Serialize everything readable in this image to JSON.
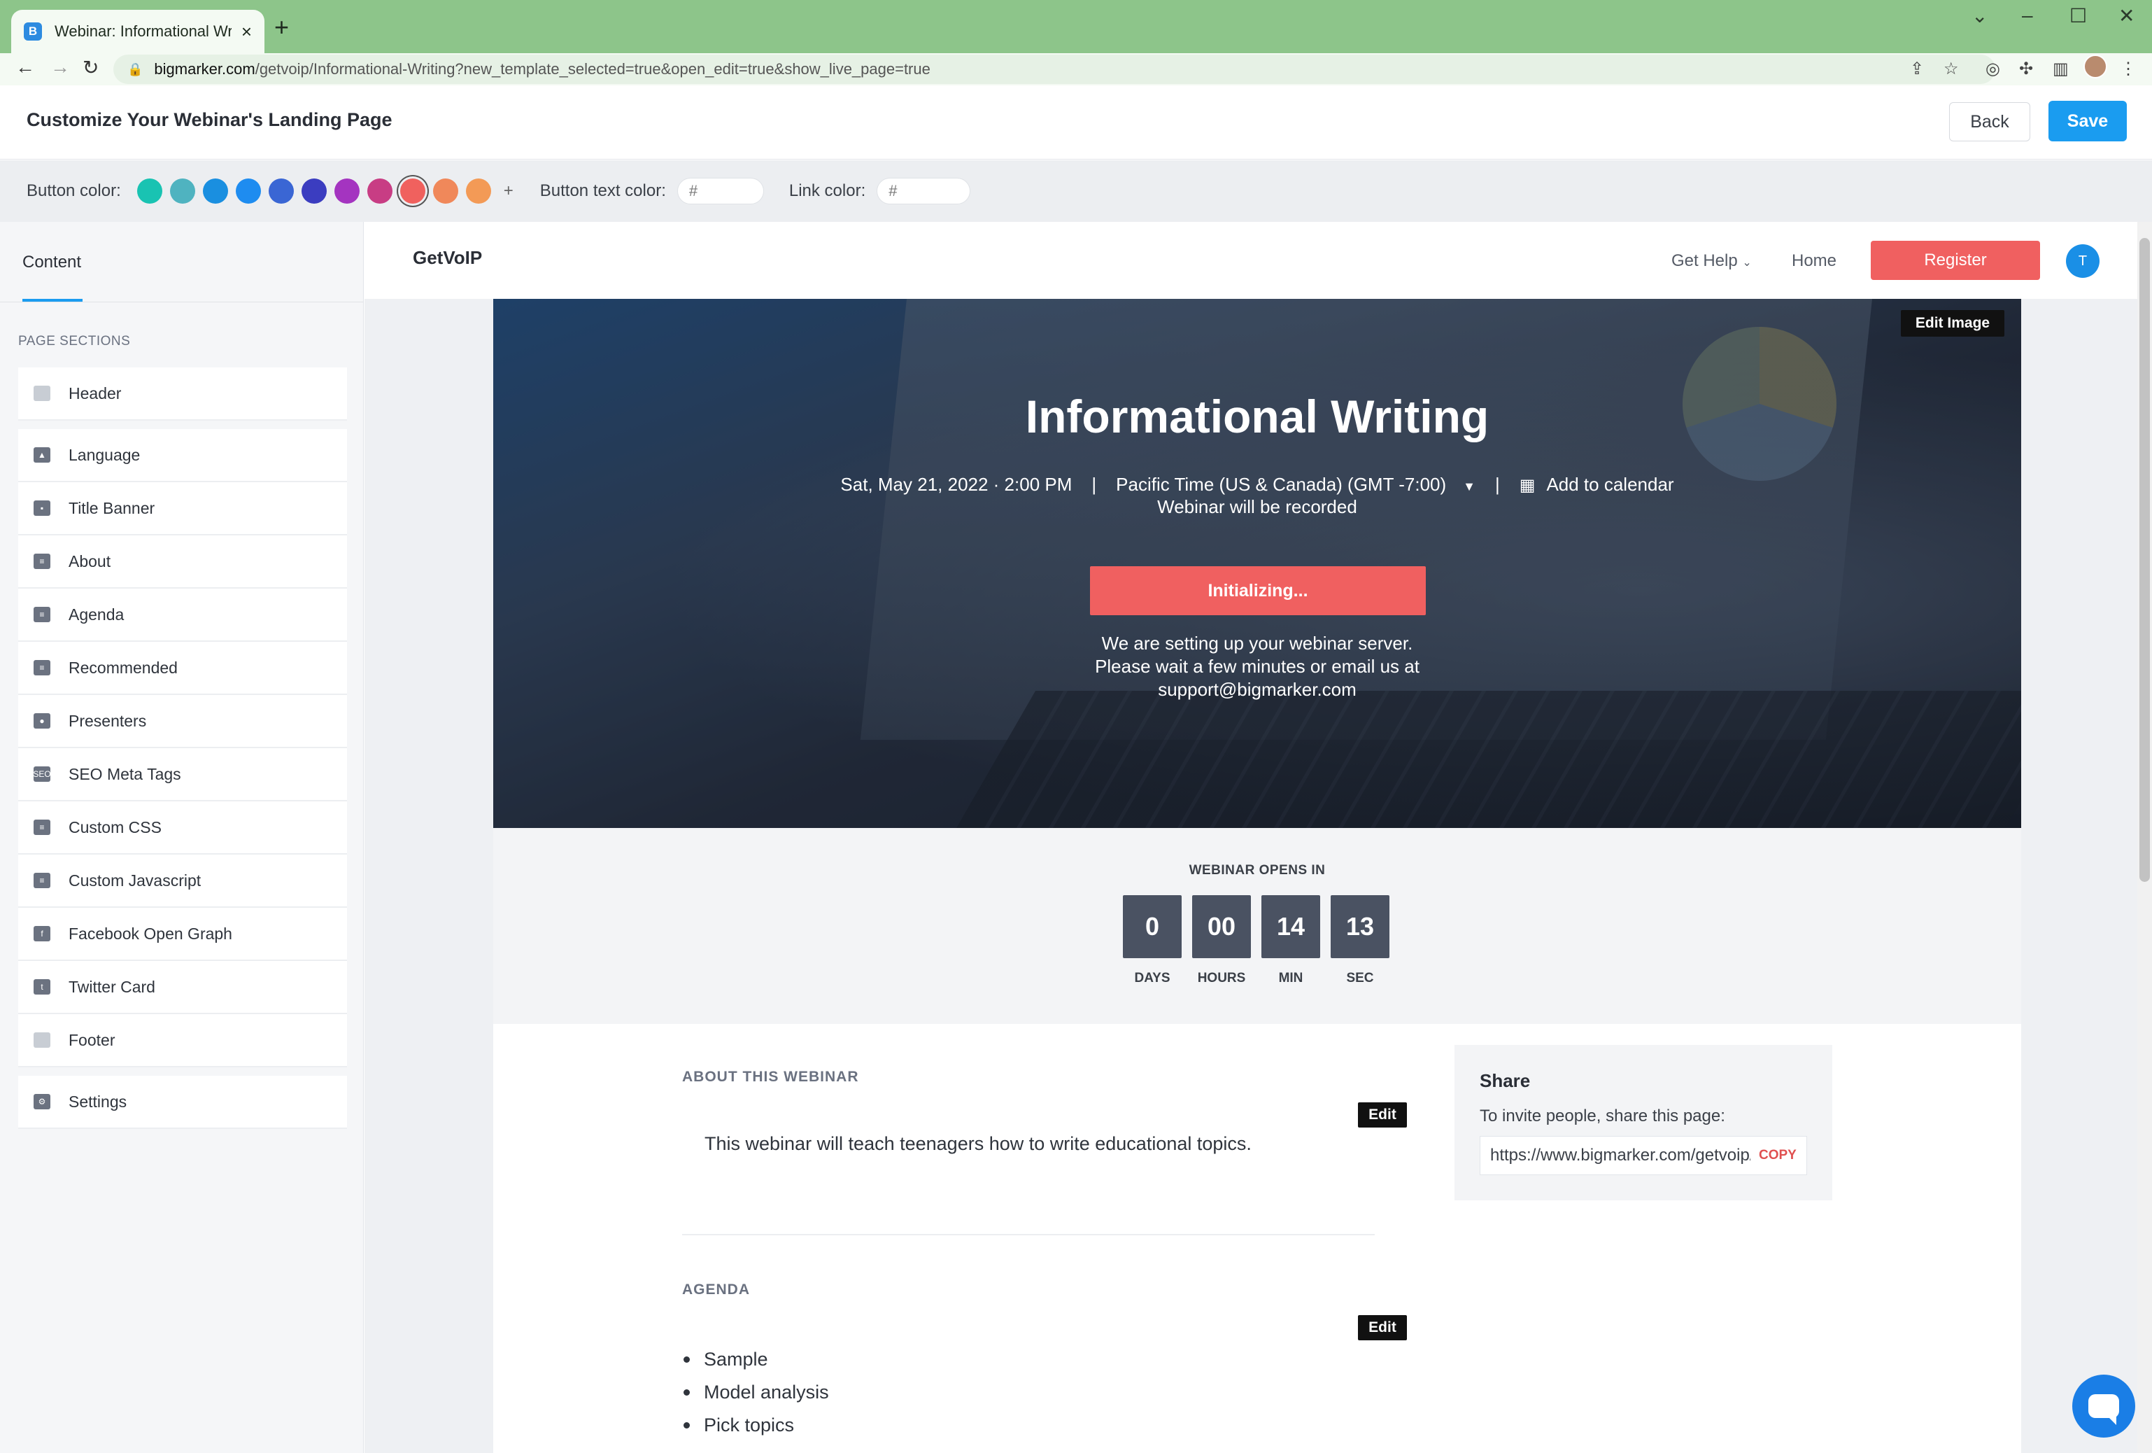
{
  "browser": {
    "tab_title": "Webinar: Informational Writing b",
    "favicon_letter": "B",
    "url_host": "bigmarker.com",
    "url_path": "/getvoip/Informational-Writing?new_template_selected=true&open_edit=true&show_live_page=true"
  },
  "app": {
    "title": "Customize Your Webinar's Landing Page",
    "back_label": "Back",
    "save_label": "Save"
  },
  "colorbar": {
    "button_color_label": "Button color:",
    "swatches": [
      "#19c3b2",
      "#4fb3c0",
      "#1a8fe0",
      "#1e8cf0",
      "#3a66d4",
      "#3b3dc0",
      "#a434c0",
      "#c83d84",
      "#f0615e",
      "#f0885a",
      "#f39a56"
    ],
    "selected_swatch": 8,
    "add_symbol": "+",
    "button_text_color_label": "Button text color:",
    "link_color_label": "Link color:",
    "hash_prefix": "#"
  },
  "sidebar": {
    "tab": "Content",
    "heading": "PAGE SECTIONS",
    "items": [
      {
        "label": "Header"
      },
      {
        "label": "Language"
      },
      {
        "label": "Title Banner"
      },
      {
        "label": "About"
      },
      {
        "label": "Agenda"
      },
      {
        "label": "Recommended"
      },
      {
        "label": "Presenters"
      },
      {
        "label": "SEO Meta Tags"
      },
      {
        "label": "Custom CSS"
      },
      {
        "label": "Custom Javascript"
      },
      {
        "label": "Facebook Open Graph"
      },
      {
        "label": "Twitter Card"
      },
      {
        "label": "Footer"
      }
    ],
    "settings": "Settings"
  },
  "site": {
    "logo": "GetVoIP",
    "get_help": "Get Help",
    "home": "Home",
    "register": "Register",
    "avatar_letter": "T"
  },
  "hero": {
    "edit_image": "Edit Image",
    "title": "Informational Writing",
    "datetime": "Sat, May 21, 2022 · 2:00 PM",
    "timezone": "Pacific Time (US & Canada) (GMT -7:00)",
    "add_to_calendar": "Add to calendar",
    "recorded": "Webinar will be recorded",
    "init_button": "Initializing...",
    "msg_line1": "We are setting up your webinar server.",
    "msg_line2": "Please wait a few minutes or email us at",
    "msg_line3": "support@bigmarker.com"
  },
  "countdown": {
    "label": "WEBINAR OPENS IN",
    "units": [
      {
        "value": "0",
        "caption": "DAYS"
      },
      {
        "value": "00",
        "caption": "HOURS"
      },
      {
        "value": "14",
        "caption": "MIN"
      },
      {
        "value": "13",
        "caption": "SEC"
      }
    ]
  },
  "about": {
    "heading": "ABOUT THIS WEBINAR",
    "edit": "Edit",
    "text": "This webinar will teach teenagers how to write educational topics."
  },
  "agenda": {
    "heading": "AGENDA",
    "edit": "Edit",
    "items": [
      "Sample",
      "Model analysis",
      "Pick topics"
    ]
  },
  "share": {
    "title": "Share",
    "subtitle": "To invite people, share this page:",
    "url": "https://www.bigmarker.com/getvoip/Informational-Writing",
    "copy": "COPY"
  }
}
